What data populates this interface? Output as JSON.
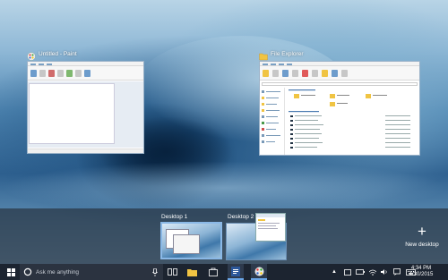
{
  "task_view": {
    "windows": [
      {
        "title": "Untitled - Paint",
        "app": "paint"
      },
      {
        "title": "File Explorer",
        "app": "file-explorer"
      }
    ]
  },
  "desktops": {
    "items": [
      {
        "label": "Desktop 1",
        "selected": true
      },
      {
        "label": "Desktop 2",
        "selected": false
      }
    ],
    "new_desktop_label": "New desktop",
    "new_desktop_icon": "+"
  },
  "taskbar": {
    "search_placeholder": "Ask me anything",
    "pinned": [
      "task-view",
      "file-explorer",
      "store",
      "word",
      "paint"
    ],
    "clock": {
      "time": "4:34 PM",
      "date": "4/30/2015"
    }
  },
  "colors": {
    "accent": "#3a8ee6",
    "taskbar": "#1c2430",
    "strip": "#283442"
  }
}
